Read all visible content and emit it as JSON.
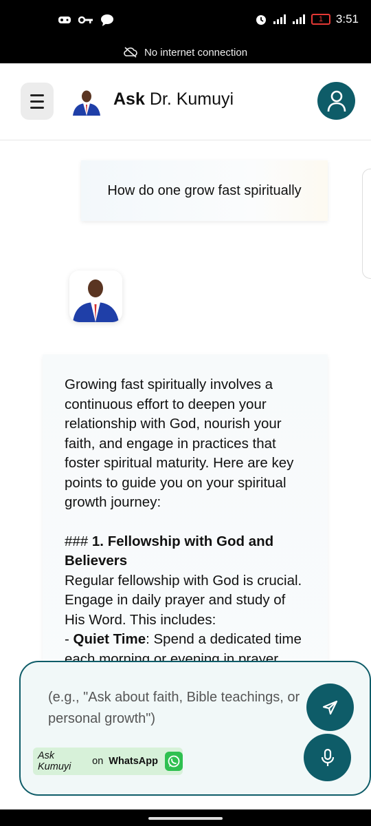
{
  "status_bar": {
    "time": "3:51",
    "battery": "1"
  },
  "network_banner": {
    "text": "No internet connection"
  },
  "header": {
    "title_bold": "Ask",
    "title_rest": " Dr. Kumuyi"
  },
  "chat": {
    "user_message": "How do one grow fast spiritually",
    "bot_response": {
      "intro": "Growing fast spiritually involves a continuous effort to deepen your relationship with God, nourish your faith, and engage in practices that foster spiritual maturity. Here are key points to guide you on your spiritual growth journey:",
      "heading_prefix": "### ",
      "heading": "1. Fellowship with God and Believers",
      "paragraph": "Regular fellowship with God is crucial. Engage in daily prayer and study of His Word. This includes:",
      "bullet_prefix": "- ",
      "bullet_lead": "Quiet Time",
      "bullet_text": ": Spend a dedicated time each morning or evening in prayer"
    }
  },
  "composer": {
    "placeholder": "(e.g., \"Ask about faith, Bible teachings, or personal growth\")",
    "whatsapp": {
      "prefix": "Ask Kumuyi",
      "middle": " on ",
      "brand": "WhatsApp"
    }
  },
  "colors": {
    "accent": "#0e5c68",
    "whatsapp_green": "#2fc050",
    "whatsapp_pill": "#d7f1d9"
  },
  "icons": {
    "menu": "hamburger-icon",
    "profile": "user-icon",
    "send": "send-icon",
    "mic": "microphone-icon",
    "whatsapp": "whatsapp-icon",
    "network": "cloud-off-icon"
  }
}
